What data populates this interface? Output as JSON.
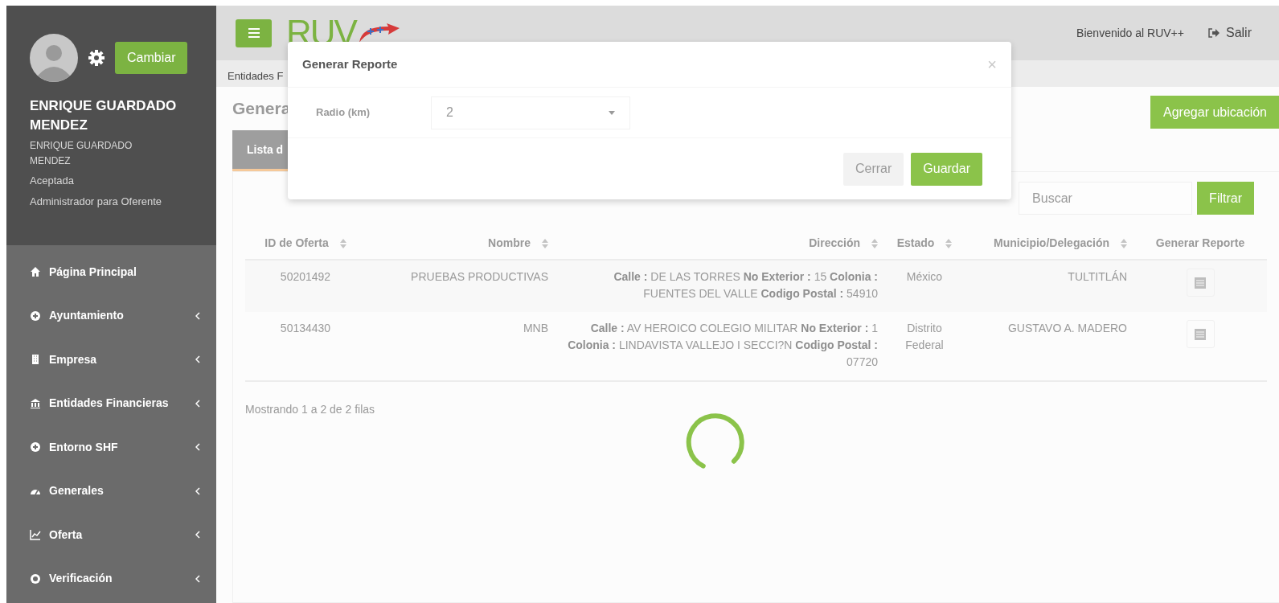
{
  "sidebar": {
    "user": {
      "name": "ENRIQUE GUARDADO MENDEZ",
      "subname": "ENRIQUE GUARDADO MENDEZ",
      "status": "Aceptada",
      "role": "Administrador para Oferente",
      "change_button": "Cambiar"
    },
    "menu": [
      {
        "label": "Página Principal",
        "kind": "home",
        "expandable": false
      },
      {
        "label": "Ayuntamiento",
        "kind": "plus",
        "expandable": true
      },
      {
        "label": "Empresa",
        "kind": "building",
        "expandable": true
      },
      {
        "label": "Entidades Financieras",
        "kind": "bank",
        "expandable": true
      },
      {
        "label": "Entorno SHF",
        "kind": "plus",
        "expandable": true
      },
      {
        "label": "Generales",
        "kind": "dashboard",
        "expandable": true
      },
      {
        "label": "Oferta",
        "kind": "chart",
        "expandable": true
      },
      {
        "label": "Verificación",
        "kind": "dot",
        "expandable": true
      }
    ]
  },
  "top_bar": {
    "logo": "RUV",
    "welcome": "Bienvenido al RUV++",
    "logout": "Salir"
  },
  "breadcrumb": "Entidades F",
  "page_title": "Genera",
  "add_button": "Agregar ubicación",
  "tabs": [
    {
      "label": "Lista d",
      "selected": true
    }
  ],
  "search": {
    "placeholder": "Buscar",
    "button": "Filtrar"
  },
  "table": {
    "columns": [
      {
        "label": "ID de Oferta",
        "sortable": true
      },
      {
        "label": "Nombre",
        "sortable": true
      },
      {
        "label": "Dirección",
        "sortable": true
      },
      {
        "label": "Estado",
        "sortable": true
      },
      {
        "label": "Municipio/Delegación",
        "sortable": true
      },
      {
        "label": "Generar Reporte",
        "sortable": false
      }
    ],
    "rows": [
      {
        "cells": [
          "50201492",
          "PRUEBAS PRODUCTIVAS",
          "**Calle :** DE LAS TORRES **No Exterior :** 15 **Colonia :** FUENTES DEL VALLE **Codigo Postal :** 54910",
          "México",
          "TULTITLÁN"
        ]
      },
      {
        "cells": [
          "50134430",
          "MNB",
          "**Calle :** AV HEROICO COLEGIO MILITAR **No Exterior :** 1 **Colonia :** LINDAVISTA VALLEJO I SECCI?N **Codigo Postal :** 07720",
          "Distrito Federal",
          "GUSTAVO A. MADERO"
        ]
      }
    ]
  },
  "pagination_info": "Mostrando 1 a 2 de 2 filas",
  "loading": true,
  "modal": {
    "title": "Generar Reporte",
    "close": "×",
    "field_label": "Radio (km)",
    "field_value": "2",
    "buttons": [
      "Cerrar",
      "Guardar"
    ]
  }
}
